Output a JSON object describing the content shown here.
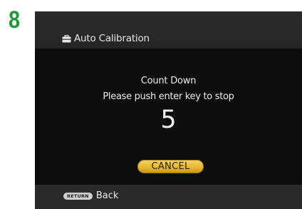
{
  "step_number": "8",
  "window": {
    "title": "Auto Calibration",
    "title_icon": "toolbox-icon"
  },
  "dialog": {
    "heading": "Count Down",
    "instruction": "Please push enter key to stop",
    "countdown_value": "5",
    "cancel_label": "CANCEL"
  },
  "footer": {
    "key_badge": "RETURN",
    "back_label": "Back"
  },
  "colors": {
    "step_number": "#1f9a3a",
    "screen_background": "#0d0d0d",
    "header_background": "#262626",
    "footer_background": "#2b2b2b",
    "button_highlight": "#e6b830"
  }
}
